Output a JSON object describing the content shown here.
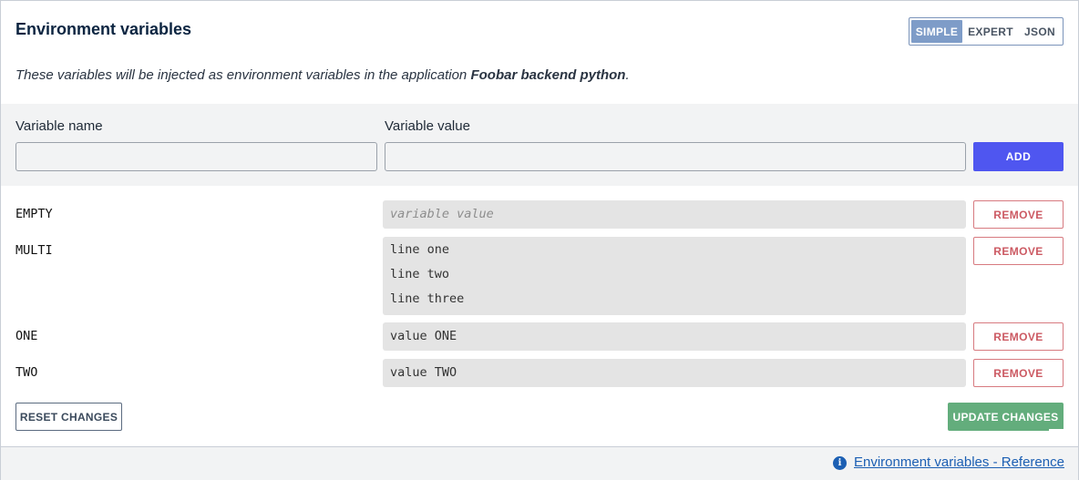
{
  "header": {
    "title": "Environment variables",
    "modes": [
      "SIMPLE",
      "EXPERT",
      "JSON"
    ],
    "active_mode": "SIMPLE"
  },
  "description": {
    "prefix": "These variables will be injected as environment variables in the application ",
    "app_name": "Foobar backend python",
    "suffix": "."
  },
  "add_form": {
    "name_label": "Variable name",
    "value_label": "Variable value",
    "name_value": "",
    "value_value": "",
    "add_label": "ADD"
  },
  "variables": [
    {
      "name": "EMPTY",
      "value_placeholder": "variable value",
      "lines": []
    },
    {
      "name": "MULTI",
      "lines": [
        "line one",
        "line two",
        "line three"
      ]
    },
    {
      "name": "ONE",
      "lines": [
        "value ONE"
      ]
    },
    {
      "name": "TWO",
      "lines": [
        "value TWO"
      ]
    }
  ],
  "remove_label": "REMOVE",
  "actions": {
    "reset_label": "RESET CHANGES",
    "update_label": "UPDATE CHANGES"
  },
  "footer": {
    "info_icon": "info-icon",
    "reference_link": "Environment variables - Reference"
  },
  "colors": {
    "accent": "#4f56f0",
    "remove": "#cc5a63",
    "update": "#63ad7c",
    "link": "#1c5fb3"
  }
}
